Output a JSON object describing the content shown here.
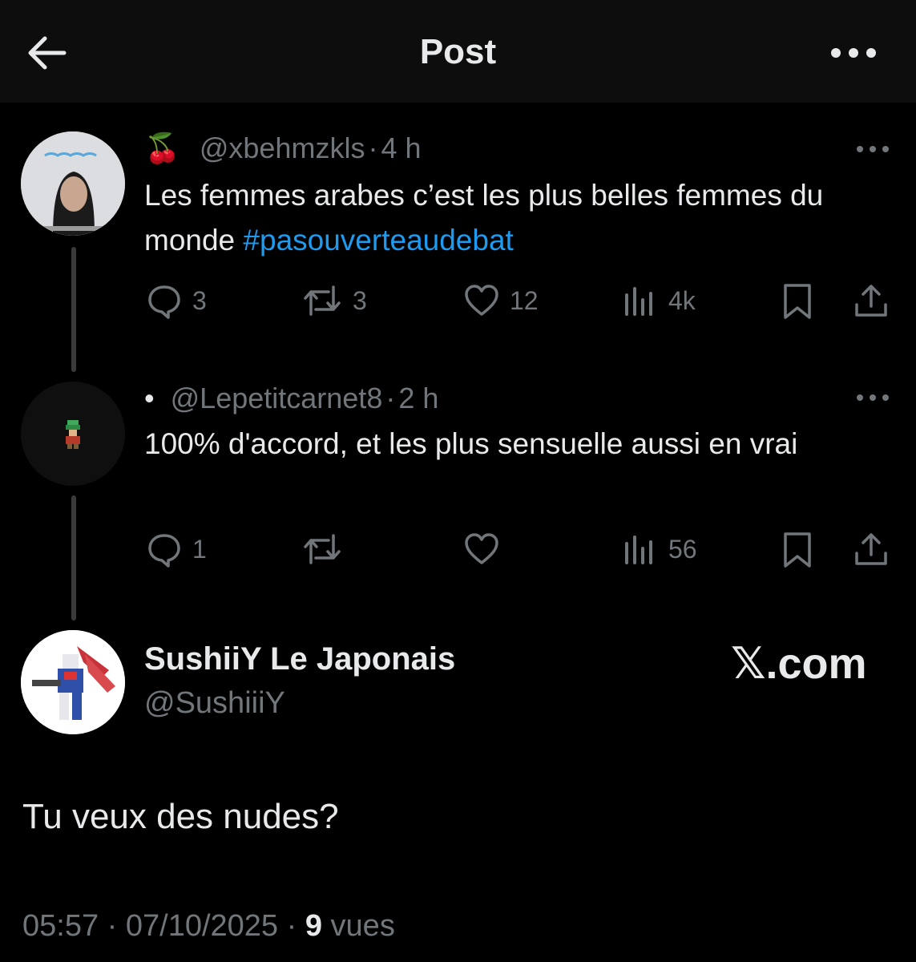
{
  "header": {
    "title": "Post"
  },
  "tweets": [
    {
      "emoji": "🍒",
      "handle": "@xbehmzkls",
      "sep": "·",
      "time": "4 h",
      "text_before": "Les femmes arabes c’est les plus belles femmes du monde ",
      "hashtag": "#pasouverteaudebat",
      "replies": "3",
      "retweets": "3",
      "likes": "12",
      "views": "4k"
    },
    {
      "bullet": "•",
      "handle": "@Lepetitcarnet8",
      "sep": "·",
      "time": "2 h",
      "text": "100% d'accord, et les plus sensuelle aussi en vrai",
      "replies": "1",
      "retweets": "",
      "likes": "",
      "views": "56"
    }
  ],
  "main_post": {
    "author_name": "SushiiY Le Japonais",
    "author_handle": "@SushiiiY",
    "watermark_x": "𝕏",
    "watermark_domain": ".com",
    "text": "Tu veux des nudes?",
    "time": "05:57",
    "sep1": "·",
    "date": "07/10/2025",
    "sep2": "·",
    "views_count": "9",
    "views_label": "vues"
  },
  "icons": {
    "back": "arrow-left-icon",
    "more": "more-horizontal-icon",
    "reply": "reply-bubble-icon",
    "retweet": "retweet-icon",
    "like": "heart-icon",
    "views": "bar-chart-icon",
    "bookmark": "bookmark-icon",
    "share": "share-upload-icon"
  },
  "colors": {
    "background": "#000000",
    "header_bg": "#0d0d0d",
    "text": "#e7e9ea",
    "muted": "#71767b",
    "link": "#1d9bf0"
  }
}
